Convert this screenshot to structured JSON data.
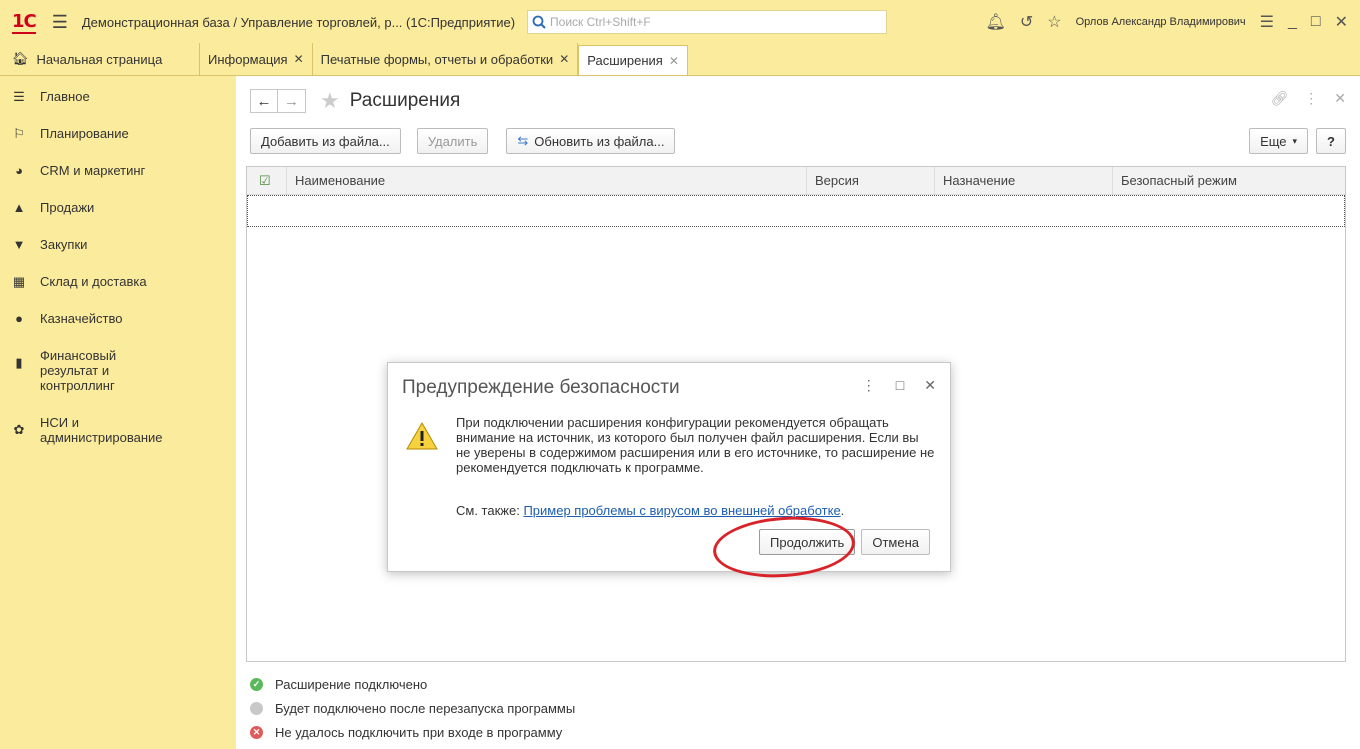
{
  "titlebar": {
    "logo": "1С",
    "title": "Демонстрационная база / Управление торговлей, р... (1С:Предприятие)",
    "search_placeholder": "Поиск Ctrl+Shift+F",
    "user": "Орлов Александр Владимирович",
    "icons": [
      "menu-icon",
      "bell-icon",
      "history-icon",
      "star-icon",
      "settings-icon",
      "minimize-icon",
      "maximize-icon",
      "close-icon"
    ]
  },
  "tabs": [
    {
      "label": "Начальная страница",
      "closable": false,
      "active": false
    },
    {
      "label": "Информация",
      "closable": true,
      "active": false
    },
    {
      "label": "Печатные формы, отчеты и обработки",
      "closable": true,
      "active": false
    },
    {
      "label": "Расширения",
      "closable": true,
      "active": true
    }
  ],
  "sidebar": {
    "items": [
      {
        "label": "Главное",
        "icon": "list-icon"
      },
      {
        "label": "Планирование",
        "icon": "planning-icon"
      },
      {
        "label": "CRM и маркетинг",
        "icon": "pie-chart-icon"
      },
      {
        "label": "Продажи",
        "icon": "bag-icon"
      },
      {
        "label": "Закупки",
        "icon": "cart-icon"
      },
      {
        "label": "Склад и доставка",
        "icon": "warehouse-icon"
      },
      {
        "label": "Казначейство",
        "icon": "coin-icon"
      },
      {
        "label": "Финансовый результат и контроллинг",
        "icon": "bar-chart-icon"
      },
      {
        "label": "НСИ и администрирование",
        "icon": "gear-icon"
      }
    ]
  },
  "main": {
    "title": "Расширения",
    "toolbar": {
      "add_from_file": "Добавить из файла...",
      "delete": "Удалить",
      "update_from_file": "Обновить из файла...",
      "more": "Еще",
      "help": "?"
    },
    "table": {
      "columns": [
        "Наименование",
        "Версия",
        "Назначение",
        "Безопасный режим"
      ],
      "rows": []
    },
    "legend": [
      {
        "label": "Расширение подключено",
        "color": "#5cb85c",
        "symbol": "✓"
      },
      {
        "label": "Будет подключено после перезапуска программы",
        "color": "#c8c8c8",
        "symbol": ""
      },
      {
        "label": "Не удалось подключить при входе в программу",
        "color": "#e05a5a",
        "symbol": "×"
      }
    ]
  },
  "dialog": {
    "title": "Предупреждение безопасности",
    "message": "При подключении расширения конфигурации рекомендуется обращать внимание на источник, из которого был получен файл расширения. Если вы не уверены в содержимом расширения или в его источнике, то расширение не рекомендуется подключать к программе.",
    "see_also_prefix": "См. также: ",
    "see_also_link": "Пример проблемы с вирусом во внешней обработке",
    "see_also_suffix": ".",
    "continue": "Продолжить",
    "cancel": "Отмена"
  },
  "colors": {
    "panel_bg": "#fbeb9c",
    "annotation_circle": "#d8232a",
    "link": "#1d5eb0"
  }
}
